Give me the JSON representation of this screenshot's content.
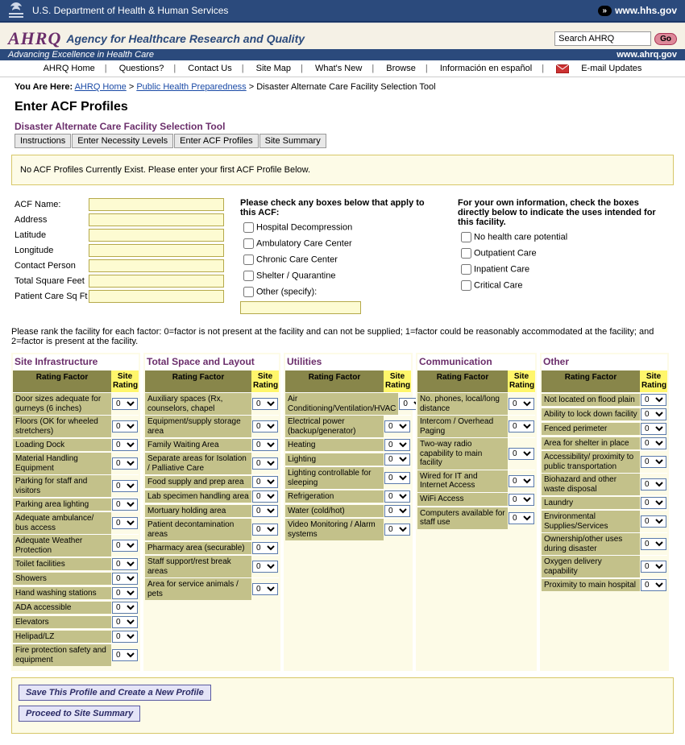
{
  "hhs": {
    "dept": "U.S. Department of Health & Human Services",
    "link": "www.hhs.gov"
  },
  "ahrq": {
    "logo": "AHRQ",
    "name": "Agency for Healthcare Research and Quality",
    "tagline": "Advancing Excellence in Health Care",
    "url": "www.ahrq.gov",
    "search_placeholder": "Search AHRQ",
    "go": "Go"
  },
  "nav": {
    "items": [
      "AHRQ Home",
      "Questions?",
      "Contact Us",
      "Site Map",
      "What's New",
      "Browse",
      "Información en español"
    ],
    "email": "E-mail Updates"
  },
  "breadcrumb": {
    "prefix": "You Are Here:",
    "links": [
      "AHRQ Home",
      "Public Health Preparedness"
    ],
    "current": "Disaster Alternate Care Facility Selection Tool"
  },
  "page_title": "Enter ACF Profiles",
  "tool_title": "Disaster Alternate Care Facility Selection Tool",
  "tabs": [
    "Instructions",
    "Enter Necessity Levels",
    "Enter ACF Profiles",
    "Site Summary"
  ],
  "notice": "No ACF Profiles Currently Exist. Please enter your first ACF Profile Below.",
  "fields": {
    "labels": [
      "ACF Name:",
      "Address",
      "Latitude",
      "Longitude",
      "Contact Person",
      "Total Square Feet",
      "Patient Care Sq Ft"
    ]
  },
  "acf_checks": {
    "hdr": "Please check any boxes below that apply to this ACF:",
    "items": [
      "Hospital Decompression",
      "Ambulatory Care Center",
      "Chronic Care Center",
      "Shelter / Quarantine",
      "Other (specify):"
    ]
  },
  "use_checks": {
    "hdr": "For your own information, check the boxes directly below to indicate the uses intended for this facility.",
    "items": [
      "No health care potential",
      "Outpatient Care",
      "Inpatient Care",
      "Critical Care"
    ]
  },
  "rank_instr": "Please rank the facility for each factor: 0=factor is not present at the facility and can not be supplied; 1=factor could be reasonably accommodated at the facility; and 2=factor is present at the facility.",
  "rating_hdr": {
    "factor": "Rating Factor",
    "site": "Site Rating"
  },
  "sections": [
    {
      "title": "Site Infrastructure",
      "factors": [
        "Door sizes adequate for gurneys (6 inches)",
        "Floors (OK for wheeled stretchers)",
        "Loading Dock",
        "Material Handling Equipment",
        "Parking for staff and visitors",
        "Parking area lighting",
        "Adequate ambulance/ bus access",
        "Adequate Weather Protection",
        "Toilet facilities",
        "Showers",
        "Hand washing stations",
        "ADA accessible",
        "Elevators",
        "Helipad/LZ",
        "Fire protection safety and equipment"
      ]
    },
    {
      "title": "Total Space and Layout",
      "factors": [
        "Auxiliary spaces (Rx, counselors, chapel",
        "Equipment/supply storage area",
        "Family Waiting Area",
        "Separate areas for Isolation / Palliative Care",
        "Food supply and prep area",
        "Lab specimen handling area",
        "Mortuary holding area",
        "Patient decontamination areas",
        "Pharmacy area (securable)",
        "Staff support/rest break areas",
        "Area for service animals / pets"
      ]
    },
    {
      "title": "Utilities",
      "factors": [
        "Air Conditioning/Ventilation/HVAC",
        "Electrical power (backup/generator)",
        "Heating",
        "Lighting",
        "Lighting controllable for sleeping",
        "Refrigeration",
        "Water (cold/hot)",
        "Video Monitoring / Alarm systems"
      ]
    },
    {
      "title": "Communication",
      "factors": [
        "No. phones, local/long distance",
        "Intercom / Overhead Paging",
        "Two-way radio capability to main facility",
        "Wired for IT and Internet Access",
        "WiFi Access",
        "Computers available for staff use"
      ]
    },
    {
      "title": "Other",
      "factors": [
        "Not located on flood plain",
        "Ability to lock down facility",
        "Fenced perimeter",
        "Area for shelter in place",
        "Accessibility/ proximity to public transportation",
        "Biohazard and other waste disposal",
        "Laundry",
        "Environmental Supplies/Services",
        "Ownership/other uses during disaster",
        "Oxygen delivery capability",
        "Proximity to main hospital"
      ]
    }
  ],
  "rating_options": [
    "0",
    "1",
    "2"
  ],
  "buttons": {
    "save": "Save This Profile and Create a New Profile",
    "proceed": "Proceed to Site Summary"
  }
}
